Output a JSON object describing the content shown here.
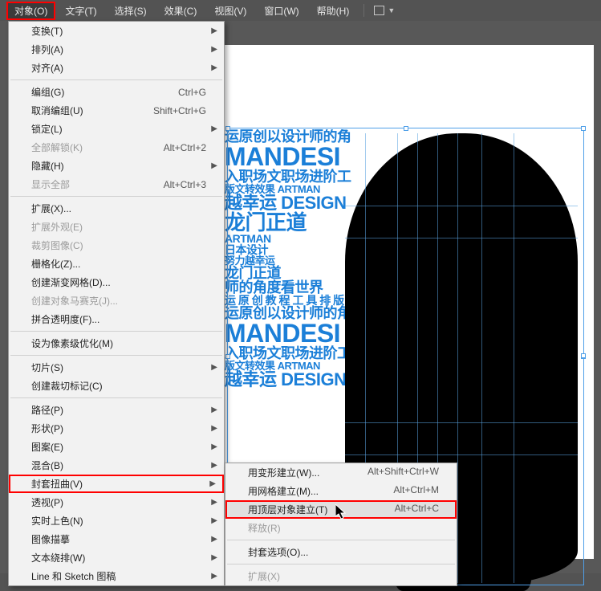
{
  "menubar": {
    "items": [
      {
        "label": "对象(O)"
      },
      {
        "label": "文字(T)"
      },
      {
        "label": "选择(S)"
      },
      {
        "label": "效果(C)"
      },
      {
        "label": "视图(V)"
      },
      {
        "label": "窗口(W)"
      },
      {
        "label": "帮助(H)"
      }
    ]
  },
  "menu": {
    "items": [
      {
        "label": "变换(T)",
        "submenu": true
      },
      {
        "label": "排列(A)",
        "submenu": true
      },
      {
        "label": "对齐(A)",
        "submenu": true
      },
      {
        "sep": true
      },
      {
        "label": "编组(G)",
        "shortcut": "Ctrl+G"
      },
      {
        "label": "取消编组(U)",
        "shortcut": "Shift+Ctrl+G"
      },
      {
        "label": "锁定(L)",
        "submenu": true
      },
      {
        "label": "全部解锁(K)",
        "shortcut": "Alt+Ctrl+2",
        "disabled": true
      },
      {
        "label": "隐藏(H)",
        "submenu": true
      },
      {
        "label": "显示全部",
        "shortcut": "Alt+Ctrl+3",
        "disabled": true
      },
      {
        "sep": true
      },
      {
        "label": "扩展(X)..."
      },
      {
        "label": "扩展外观(E)",
        "disabled": true
      },
      {
        "label": "裁剪图像(C)",
        "disabled": true
      },
      {
        "label": "栅格化(Z)..."
      },
      {
        "label": "创建渐变网格(D)..."
      },
      {
        "label": "创建对象马赛克(J)...",
        "disabled": true
      },
      {
        "label": "拼合透明度(F)..."
      },
      {
        "sep": true
      },
      {
        "label": "设为像素级优化(M)"
      },
      {
        "sep": true
      },
      {
        "label": "切片(S)",
        "submenu": true
      },
      {
        "label": "创建裁切标记(C)"
      },
      {
        "sep": true
      },
      {
        "label": "路径(P)",
        "submenu": true
      },
      {
        "label": "形状(P)",
        "submenu": true
      },
      {
        "label": "图案(E)",
        "submenu": true
      },
      {
        "label": "混合(B)",
        "submenu": true
      },
      {
        "label": "封套扭曲(V)",
        "submenu": true,
        "highlighted": true
      },
      {
        "label": "透视(P)",
        "submenu": true
      },
      {
        "label": "实时上色(N)",
        "submenu": true
      },
      {
        "label": "图像描摹",
        "submenu": true
      },
      {
        "label": "文本绕排(W)",
        "submenu": true
      },
      {
        "label": "Line 和 Sketch 图稿",
        "submenu": true
      }
    ]
  },
  "submenu": {
    "items": [
      {
        "label": "用变形建立(W)...",
        "shortcut": "Alt+Shift+Ctrl+W"
      },
      {
        "label": "用网格建立(M)...",
        "shortcut": "Alt+Ctrl+M"
      },
      {
        "label": "用顶层对象建立(T)",
        "shortcut": "Alt+Ctrl+C",
        "highlighted": true
      },
      {
        "label": "释放(R)",
        "disabled": true
      },
      {
        "sep": true
      },
      {
        "label": "封套选项(O)..."
      },
      {
        "sep": true
      },
      {
        "label": "扩展(X)",
        "disabled": true
      }
    ]
  },
  "canvas_text": {
    "l1": "运原创以设计师的角",
    "l2": "MANDESI",
    "l3": "入职场文职场进阶工",
    "l4": "版文转效果  ARTMAN",
    "l5": "越幸运 DESIGN",
    "l6": "龙门正道",
    "l7": "ARTMAN",
    "l8": "日本设计",
    "l9": "努力越幸运",
    "l10": "龙门正道",
    "l11": "师的角度看世界",
    "l12": "运 原 创 教 程 工 具 排 版 文",
    "l13": "运原创以设计师的角",
    "l14": "MANDESI",
    "l15": "入职场文职场进阶工庞",
    "l16": "版文转效果  ARTMAN",
    "l17": "越幸运 DESIGN 门"
  }
}
